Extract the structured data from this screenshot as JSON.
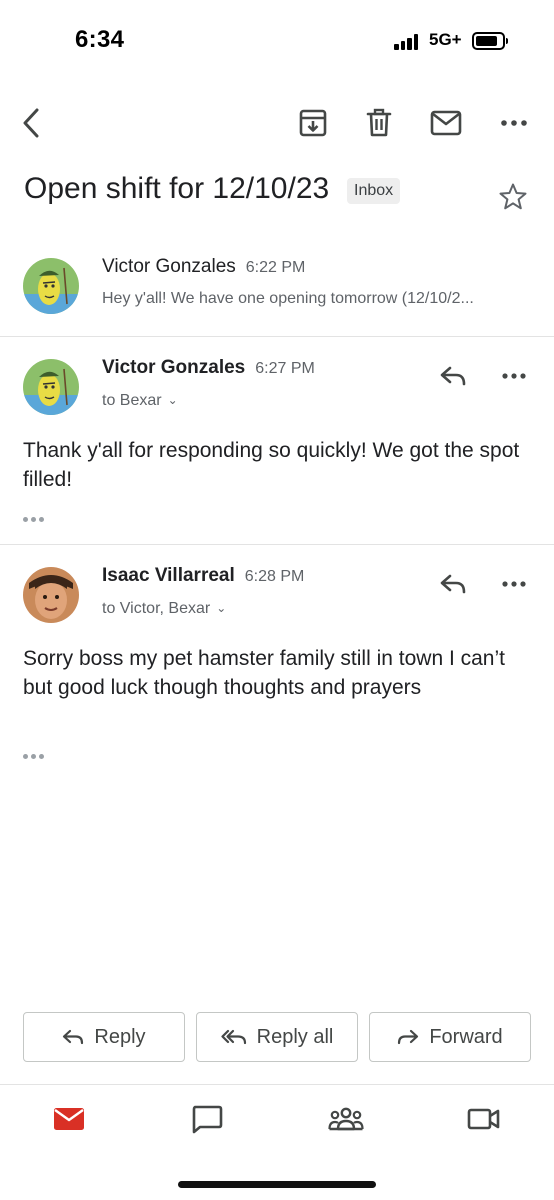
{
  "status_bar": {
    "time": "6:34",
    "network": "5G+"
  },
  "toolbar": {
    "icons": [
      "back-icon",
      "archive-icon",
      "delete-icon",
      "mark-unread-icon",
      "more-icon"
    ]
  },
  "email": {
    "subject": "Open shift for 12/10/23",
    "label": "Inbox"
  },
  "messages": [
    {
      "sender": "Victor Gonzales",
      "time": "6:22 PM",
      "snippet": "Hey y'all! We have one opening tomorrow (12/10/2...",
      "collapsed": true
    },
    {
      "sender": "Victor Gonzales",
      "time": "6:27 PM",
      "recipients": "to Bexar",
      "body": "Thank y'all for responding so quickly! We got the spot filled!"
    },
    {
      "sender": "Isaac Villarreal",
      "time": "6:28 PM",
      "recipients": "to Victor, Bexar",
      "body": "Sorry boss my pet hamster family still in town I can’t but good luck though thoughts and prayers"
    }
  ],
  "actions": {
    "reply": "Reply",
    "reply_all": "Reply all",
    "forward": "Forward"
  },
  "bottom_nav": {
    "items": [
      "mail-icon",
      "chat-icon",
      "spaces-icon",
      "meet-icon"
    ],
    "active": "mail-icon",
    "active_color": "#d93025"
  }
}
